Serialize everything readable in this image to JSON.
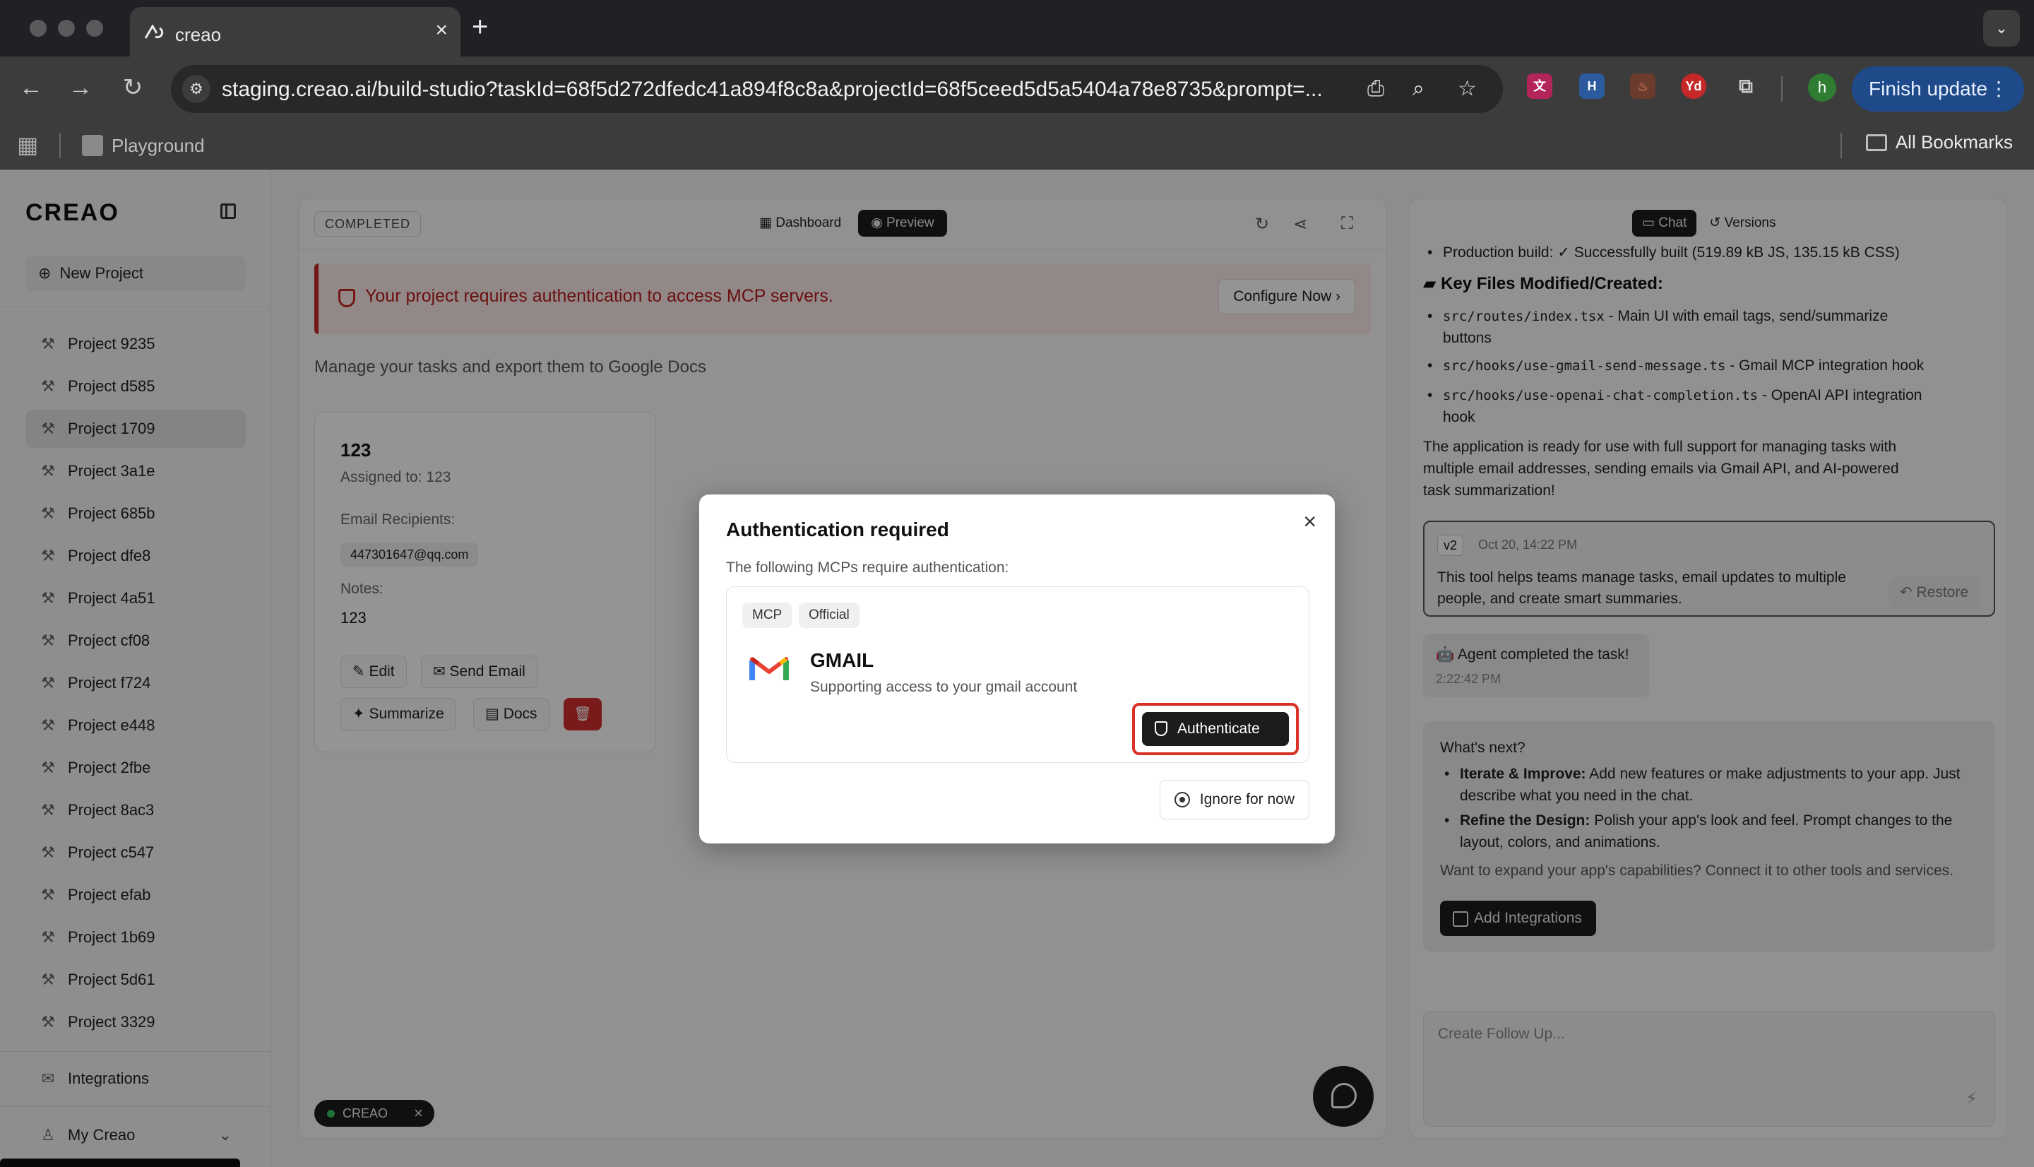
{
  "browser": {
    "tab_title": "creao",
    "url": "staging.creao.ai/build-studio?taskId=68f5d272dfedc41a894f8c8a&projectId=68f5ceed5d5a5404a78e8735&prompt=...",
    "finish_update": "Finish update",
    "profile_initial": "h",
    "bookmark_playground": "Playground",
    "all_bookmarks": "All Bookmarks"
  },
  "sidebar": {
    "logo": "CREAO",
    "new_project": "New Project",
    "projects": [
      "Project 9235",
      "Project d585",
      "Project 1709",
      "Project 3a1e",
      "Project 685b",
      "Project dfe8",
      "Project 4a51",
      "Project cf08",
      "Project f724",
      "Project e448",
      "Project 2fbe",
      "Project 8ac3",
      "Project c547",
      "Project efab",
      "Project 1b69",
      "Project 5d61",
      "Project 3329"
    ],
    "active_project": "Project 1709",
    "integrations": "Integrations",
    "my_creao": "My Creao"
  },
  "center": {
    "status": "COMPLETED",
    "tab_dashboard": "Dashboard",
    "tab_preview": "Preview",
    "alert_text": "Your project requires authentication to access MCP servers.",
    "configure_now": "Configure Now",
    "subtitle": "Manage your tasks and export them to Google Docs",
    "task": {
      "title": "123",
      "assigned": "Assigned to: 123",
      "email_label": "Email Recipients:",
      "email": "447301647@qq.com",
      "notes_label": "Notes:",
      "notes": "123",
      "edit": "Edit",
      "send_email": "Send Email",
      "summarize": "Summarize",
      "docs": "Docs"
    },
    "badge": "CREAO"
  },
  "right": {
    "tab_chat": "Chat",
    "tab_versions": "Versions",
    "build_line": "Production build: ✓ Successfully built (519.89 kB JS, 135.15 kB CSS)",
    "files_heading": "Key Files Modified/Created:",
    "file1_path": "src/routes/index.tsx",
    "file1_desc": " - Main UI with email tags, send/summarize",
    "file1_desc2": "buttons",
    "file2_path": "src/hooks/use-gmail-send-message.ts",
    "file2_desc": " - Gmail MCP integration hook",
    "file3_path": "src/hooks/use-openai-chat-completion.ts",
    "file3_desc": " - OpenAI API integration",
    "file3_desc2": "hook",
    "ready_1": "The application is ready for use with full support for managing tasks with",
    "ready_2": "multiple email addresses, sending emails via Gmail API, and AI-powered",
    "ready_3": "task summarization!",
    "version_badge": "v2",
    "version_date": "Oct 20, 14:22 PM",
    "version_text": "This tool helps teams manage tasks, email updates to multiple people, and create smart summaries.",
    "restore": "Restore",
    "agent_done": "🤖 Agent completed the task!",
    "agent_time": "2:22:42 PM",
    "next_title": "What's next?",
    "iterate_label": "Iterate & Improve:",
    "iterate_text_1": " Add new features or make adjustments to your app. Just",
    "iterate_text_2": "describe what you need in the chat.",
    "refine_label": "Refine the Design:",
    "refine_text_1": " Polish your app's look and feel. Prompt changes to the",
    "refine_text_2": "layout, colors, and animations.",
    "expand": "Want to expand your app's capabilities? Connect it to other tools and services.",
    "add_integrations": "Add Integrations",
    "followup_placeholder": "Create Follow Up..."
  },
  "modal": {
    "title": "Authentication required",
    "desc": "The following MCPs require authentication:",
    "tag_mcp": "MCP",
    "tag_official": "Official",
    "name": "GMAIL",
    "sub": "Supporting access to your gmail account",
    "authenticate": "Authenticate",
    "ignore": "Ignore for now"
  },
  "colors": {
    "accent_dark": "#1c1c1c",
    "alert_red": "#c62828",
    "highlight_red": "#d93025"
  }
}
